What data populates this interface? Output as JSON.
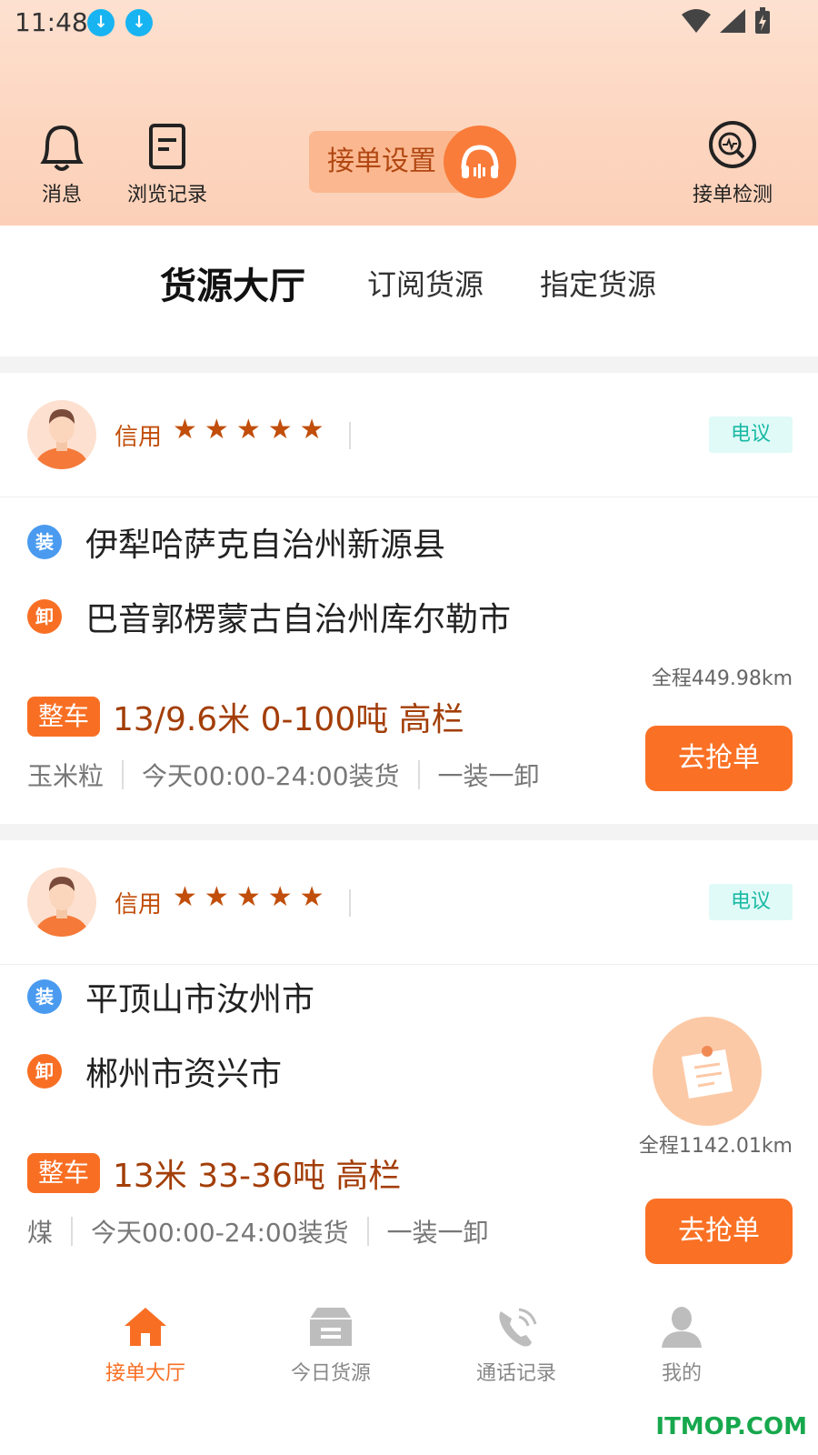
{
  "status_bar": {
    "time": "11:48"
  },
  "header": {
    "messages_label": "消息",
    "history_label": "浏览记录",
    "order_settings_label": "接单设置",
    "order_check_label": "接单检测"
  },
  "tabs": [
    {
      "label": "货源大厅",
      "active": true
    },
    {
      "label": "订阅货源",
      "active": false
    },
    {
      "label": "指定货源",
      "active": false
    }
  ],
  "cards": [
    {
      "credit_label": "信用",
      "stars": 5,
      "badge": "电议",
      "load_icon": "装",
      "from": "伊犁哈萨克自治州新源县",
      "unload_icon": "卸",
      "to": "巴音郭楞蒙古自治州库尔勒市",
      "distance": "全程449.98km",
      "tag": "整车",
      "spec": "13/9.6米 0-100吨 高栏",
      "cargo": "玉米粒",
      "time": "今天00:00-24:00装货",
      "mode": "一装一卸",
      "action": "去抢单"
    },
    {
      "credit_label": "信用",
      "stars": 5,
      "badge": "电议",
      "load_icon": "装",
      "from": "平顶山市汝州市",
      "unload_icon": "卸",
      "to": "郴州市资兴市",
      "distance": "全程1142.01km",
      "tag": "整车",
      "spec": "13米 33-36吨 高栏",
      "cargo": "煤",
      "time": "今天00:00-24:00装货",
      "mode": "一装一卸",
      "action": "去抢单"
    }
  ],
  "bottom_nav": [
    {
      "label": "接单大厅",
      "icon": "home-icon",
      "active": true
    },
    {
      "label": "今日货源",
      "icon": "box-icon",
      "active": false
    },
    {
      "label": "通话记录",
      "icon": "phone-icon",
      "active": false
    },
    {
      "label": "我的",
      "icon": "user-icon",
      "active": false
    }
  ],
  "watermark": "ITMOP.COM",
  "colors": {
    "accent": "#f86f24",
    "credit": "#c14e0a",
    "badge_text": "#18b9a4"
  }
}
